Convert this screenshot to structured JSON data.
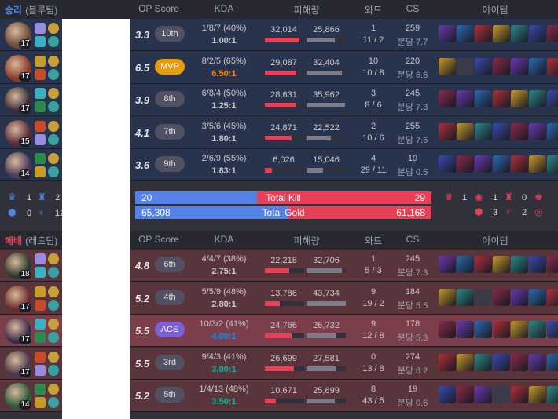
{
  "header": {
    "columns": [
      "OP Score",
      "KDA",
      "피해량",
      "와드",
      "CS",
      "아이템"
    ]
  },
  "blue_team": {
    "result": "승리",
    "side": "(블루팀)",
    "result_color": "#5383e8"
  },
  "red_team": {
    "result": "패배",
    "side": "(레드팀)",
    "result_color": "#e84057"
  },
  "blue_players": [
    {
      "level": "17",
      "score": "3.3",
      "rank": "10th",
      "kda_line": "1/8/7 (40%)",
      "kda_ratio": "1.00:1",
      "dealt": "32,014",
      "taken": "25,866",
      "dealt_pct": 0.88,
      "taken_pct": 0.71,
      "wards": "1",
      "wards_pd": "11 / 2",
      "cs": "259",
      "cs_min": "분당 7.7"
    },
    {
      "level": "17",
      "score": "6.5",
      "rank": "MVP",
      "kda_line": "8/2/5 (65%)",
      "kda_ratio": "6.50:1",
      "dealt": "29,087",
      "taken": "32,404",
      "dealt_pct": 0.8,
      "taken_pct": 0.89,
      "wards": "10",
      "wards_pd": "10 / 8",
      "cs": "220",
      "cs_min": "분당 6.6"
    },
    {
      "level": "17",
      "score": "3.9",
      "rank": "8th",
      "kda_line": "6/8/4 (50%)",
      "kda_ratio": "1.25:1",
      "dealt": "28,631",
      "taken": "35,962",
      "dealt_pct": 0.78,
      "taken_pct": 0.98,
      "wards": "3",
      "wards_pd": "8 / 6",
      "cs": "245",
      "cs_min": "분당 7.3"
    },
    {
      "level": "15",
      "score": "4.1",
      "rank": "7th",
      "kda_line": "3/5/6 (45%)",
      "kda_ratio": "1.80:1",
      "dealt": "24,871",
      "taken": "22,522",
      "dealt_pct": 0.68,
      "taken_pct": 0.62,
      "wards": "2",
      "wards_pd": "10 / 6",
      "cs": "255",
      "cs_min": "분당 7.6"
    },
    {
      "level": "14",
      "score": "3.6",
      "rank": "9th",
      "kda_line": "2/6/9 (55%)",
      "kda_ratio": "1.83:1",
      "dealt": "6,026",
      "taken": "15,046",
      "dealt_pct": 0.17,
      "taken_pct": 0.41,
      "wards": "4",
      "wards_pd": "29 / 11",
      "cs": "19",
      "cs_min": "분당 0.6"
    }
  ],
  "red_players": [
    {
      "level": "18",
      "score": "4.8",
      "rank": "6th",
      "kda_line": "4/4/7 (38%)",
      "kda_ratio": "2.75:1",
      "dealt": "22,218",
      "taken": "32,706",
      "dealt_pct": 0.61,
      "taken_pct": 0.89,
      "wards": "1",
      "wards_pd": "5 / 3",
      "cs": "245",
      "cs_min": "분당 7.3"
    },
    {
      "level": "17",
      "score": "5.2",
      "rank": "4th",
      "kda_line": "5/5/9 (48%)",
      "kda_ratio": "2.80:1",
      "dealt": "13,786",
      "taken": "43,734",
      "dealt_pct": 0.38,
      "taken_pct": 1.0,
      "wards": "9",
      "wards_pd": "19 / 2",
      "cs": "184",
      "cs_min": "분당 5.5"
    },
    {
      "level": "17",
      "score": "5.5",
      "rank": "ACE",
      "kda_line": "10/3/2 (41%)",
      "kda_ratio": "4.00:1",
      "dealt": "24,766",
      "taken": "26,732",
      "dealt_pct": 0.68,
      "taken_pct": 0.73,
      "wards": "9",
      "wards_pd": "12 / 8",
      "cs": "178",
      "cs_min": "분당 5.3"
    },
    {
      "level": "17",
      "score": "5.5",
      "rank": "3rd",
      "kda_line": "9/4/3 (41%)",
      "kda_ratio": "3.00:1",
      "dealt": "26,699",
      "taken": "27,581",
      "dealt_pct": 0.73,
      "taken_pct": 0.76,
      "wards": "0",
      "wards_pd": "13 / 8",
      "cs": "274",
      "cs_min": "분당 8.2"
    },
    {
      "level": "14",
      "score": "5.2",
      "rank": "5th",
      "kda_line": "1/4/13 (48%)",
      "kda_ratio": "3.50:1",
      "dealt": "10,671",
      "taken": "25,699",
      "dealt_pct": 0.29,
      "taken_pct": 0.71,
      "wards": "8",
      "wards_pd": "43 / 5",
      "cs": "19",
      "cs_min": "분당 0.6"
    }
  ],
  "summary": {
    "kill_title": "Total Kill",
    "kill_blue": "20",
    "kill_red": "29",
    "kill_blue_frac": 0.41,
    "gold_title": "Total Gold",
    "gold_blue": "65,308",
    "gold_red": "61,168",
    "gold_blue_frac": 0.517,
    "blue_objectives": [
      {
        "icon": "baron-icon",
        "value": "1"
      },
      {
        "icon": "dragon-icon",
        "value": "2"
      },
      {
        "icon": "tower-icon",
        "value": "0"
      },
      {
        "icon": "inhibitor-icon",
        "value": "12"
      }
    ],
    "red_objectives": [
      {
        "icon": "baron-icon",
        "value": "1"
      },
      {
        "icon": "herald-icon",
        "value": "1"
      },
      {
        "icon": "dragon-icon",
        "value": "0"
      },
      {
        "icon": "tower-icon",
        "value": "3"
      },
      {
        "icon": "inhibitor-icon",
        "value": "2"
      },
      {
        "icon": "nexus-icon",
        "value": "0"
      }
    ]
  },
  "colors": {
    "win_row": "#28344e",
    "lose_row": "#59343b",
    "dealt_bar": "#e84057",
    "taken_bar": "#7b7b8a"
  }
}
